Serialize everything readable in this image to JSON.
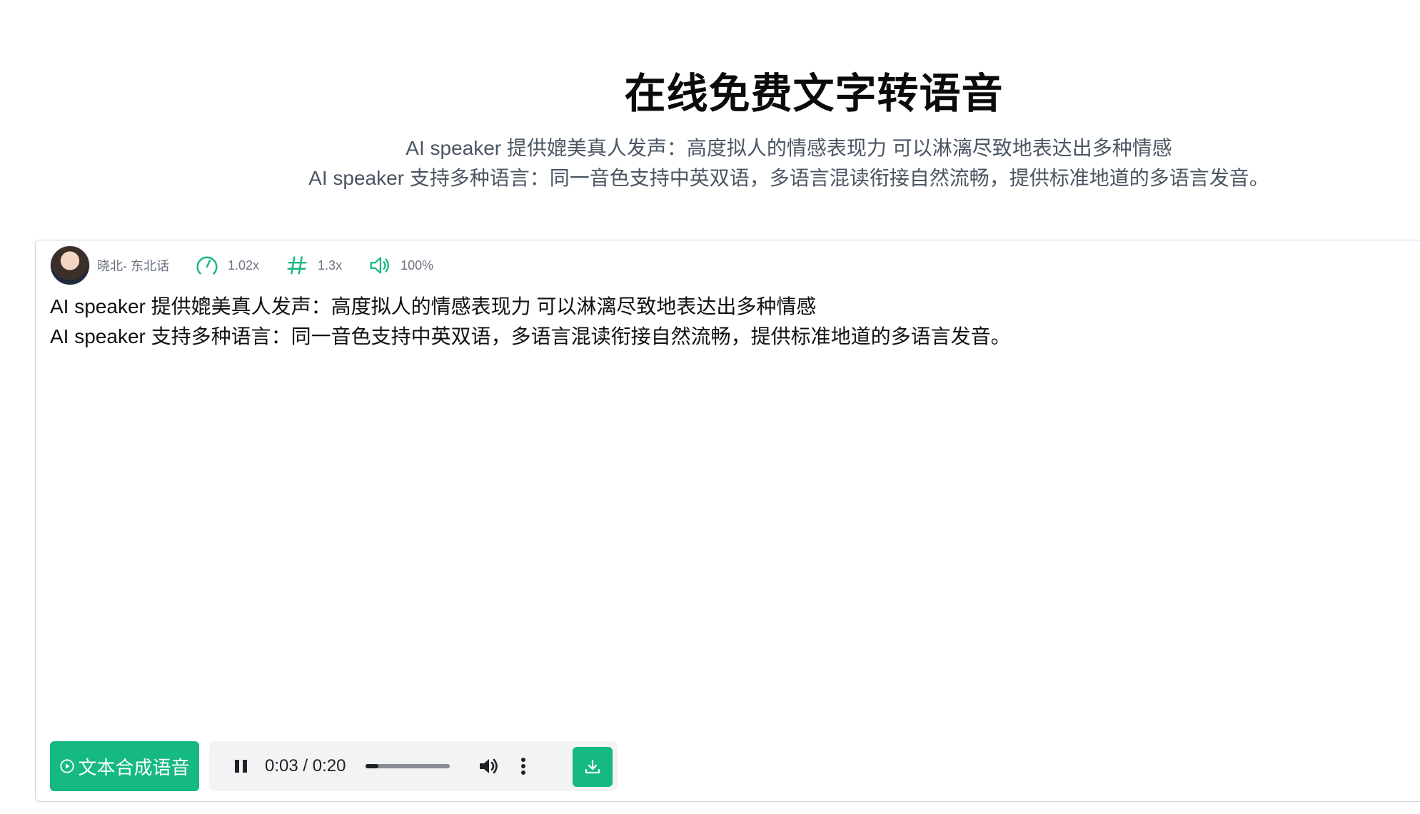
{
  "header": {
    "title": "在线免费文字转语音",
    "subtitle_line1": "AI speaker 提供媲美真人发声：高度拟人的情感表现力 可以淋漓尽致地表达出多种情感",
    "subtitle_line2": "AI speaker 支持多种语言：同一音色支持中英双语，多语言混读衔接自然流畅，提供标准地道的多语言发音。"
  },
  "toolbar": {
    "voice_name": "晓北- 东北话",
    "speed_value": "1.02x",
    "pitch_value": "1.3x",
    "volume_value": "100%",
    "icons": [
      "avatar",
      "speedometer-icon",
      "hash-icon",
      "speaker-icon"
    ]
  },
  "editor": {
    "line1": "AI speaker 提供媲美真人发声：高度拟人的情感表现力 可以淋漓尽致地表达出多种情感",
    "line2": "AI speaker 支持多种语言：同一音色支持中英双语，多语言混读衔接自然流畅，提供标准地道的多语言发音。"
  },
  "controls": {
    "synth_label": "文本合成语音",
    "player": {
      "time_display": "0:03 / 0:20",
      "current_seconds": 3,
      "duration_seconds": 20
    }
  },
  "colors": {
    "accent": "#15b981",
    "text": "#111111",
    "muted": "#6b7280",
    "player_bg": "#f1f3f4"
  }
}
